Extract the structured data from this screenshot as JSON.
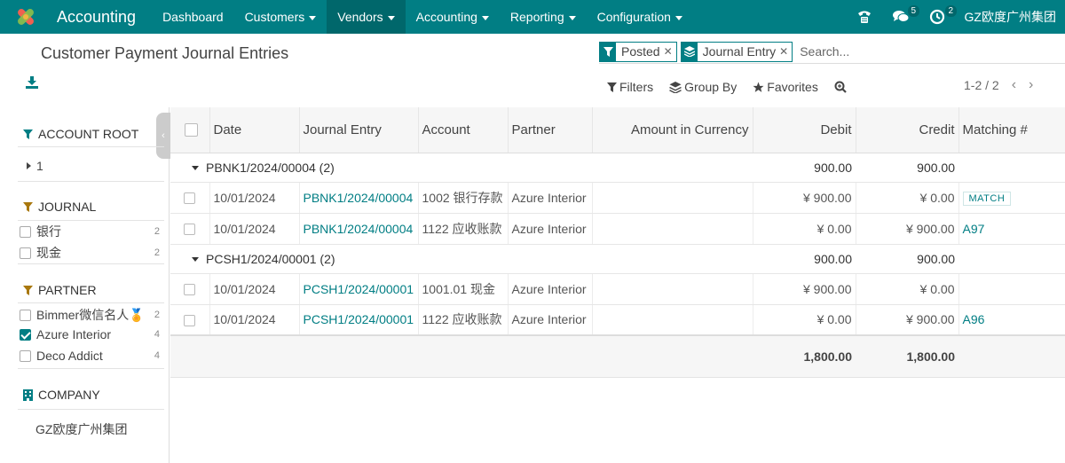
{
  "navbar": {
    "app_title": "Accounting",
    "menu": [
      {
        "label": "Dashboard",
        "dropdown": false
      },
      {
        "label": "Customers",
        "dropdown": true
      },
      {
        "label": "Vendors",
        "dropdown": true
      },
      {
        "label": "Accounting",
        "dropdown": true
      },
      {
        "label": "Reporting",
        "dropdown": true
      },
      {
        "label": "Configuration",
        "dropdown": true
      }
    ],
    "messages_count": "5",
    "activities_count": "2",
    "company": "GZ欧度广州集团"
  },
  "control_panel": {
    "title": "Customer Payment Journal Entries",
    "facets": [
      {
        "label": "Posted",
        "icon": "filter-icon"
      },
      {
        "label": "Journal Entry",
        "icon": "layers-icon"
      }
    ],
    "search_placeholder": "Search...",
    "filters_label": "Filters",
    "groupby_label": "Group By",
    "favorites_label": "Favorites",
    "pager": "1-2 / 2"
  },
  "sidepanel": {
    "account_root": {
      "header": "ACCOUNT ROOT",
      "items": [
        {
          "label": "1"
        }
      ]
    },
    "journal": {
      "header": "JOURNAL",
      "items": [
        {
          "label": "银行",
          "count": "2"
        },
        {
          "label": "现金",
          "count": "2"
        }
      ]
    },
    "partner": {
      "header": "PARTNER",
      "items": [
        {
          "label": "Bimmer微信名人🏅",
          "count": "2",
          "checked": false
        },
        {
          "label": "Azure Interior",
          "count": "4",
          "checked": true
        },
        {
          "label": "Deco Addict",
          "count": "4",
          "checked": false
        }
      ]
    },
    "company": {
      "header": "COMPANY",
      "items": [
        {
          "label": "GZ欧度广州集团"
        }
      ]
    }
  },
  "table": {
    "columns": [
      "Date",
      "Journal Entry",
      "Account",
      "Partner",
      "Amount in Currency",
      "Debit",
      "Credit",
      "Matching #"
    ],
    "groups": [
      {
        "label": "PBNK1/2024/00004 (2)",
        "debit": "900.00",
        "credit": "900.00",
        "rows": [
          {
            "date": "10/01/2024",
            "entry": "PBNK1/2024/00004",
            "account": "1002 银行存款",
            "partner": "Azure Interior",
            "amount_currency": "",
            "debit": "¥ 900.00",
            "credit": "¥ 0.00",
            "matching": "MATCH",
            "matching_is_button": true
          },
          {
            "date": "10/01/2024",
            "entry": "PBNK1/2024/00004",
            "account": "1122 应收账款",
            "partner": "Azure Interior",
            "amount_currency": "",
            "debit": "¥ 0.00",
            "credit": "¥ 900.00",
            "matching": "A97",
            "matching_is_button": false
          }
        ]
      },
      {
        "label": "PCSH1/2024/00001 (2)",
        "debit": "900.00",
        "credit": "900.00",
        "rows": [
          {
            "date": "10/01/2024",
            "entry": "PCSH1/2024/00001",
            "account": "1001.01 现金",
            "partner": "Azure Interior",
            "amount_currency": "",
            "debit": "¥ 900.00",
            "credit": "¥ 0.00",
            "matching": "",
            "matching_is_button": false
          },
          {
            "date": "10/01/2024",
            "entry": "PCSH1/2024/00001",
            "account": "1122 应收账款",
            "partner": "Azure Interior",
            "amount_currency": "",
            "debit": "¥ 0.00",
            "credit": "¥ 900.00",
            "matching": "A96",
            "matching_is_button": false
          }
        ]
      }
    ],
    "total_debit": "1,800.00",
    "total_credit": "1,800.00"
  },
  "colors": {
    "primary": "#017e84",
    "primary_dark": "#00676b"
  }
}
